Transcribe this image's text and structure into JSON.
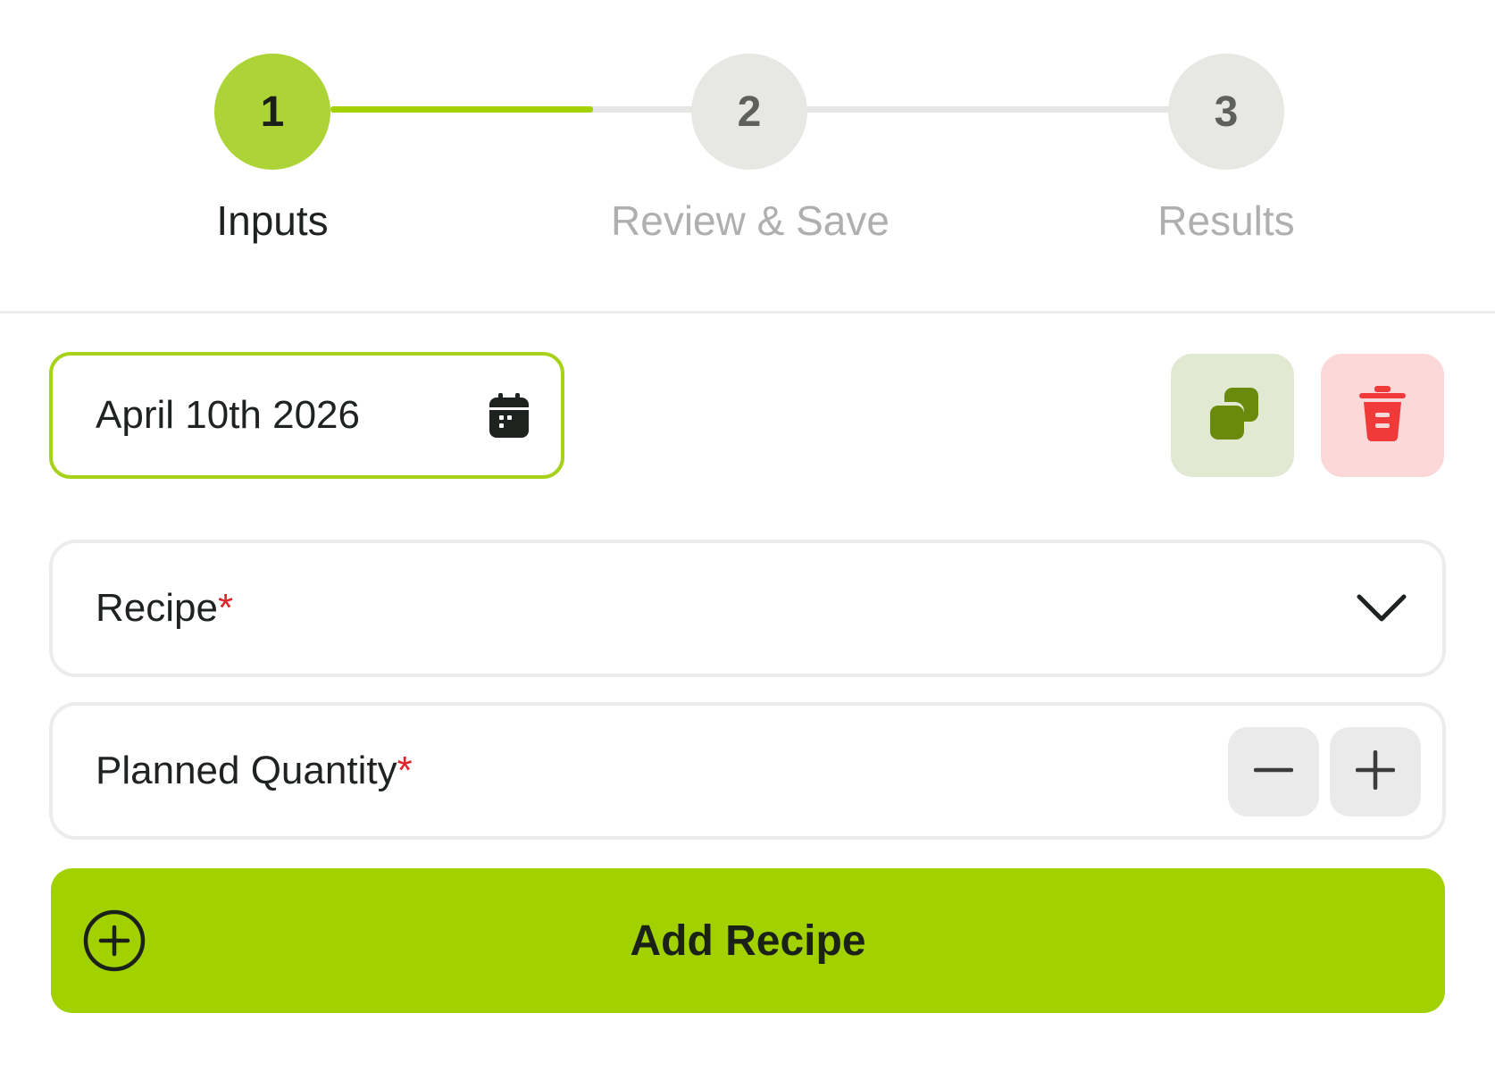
{
  "stepper": {
    "current_step": 1,
    "progress_to_next": 0.55,
    "steps": [
      {
        "number": "1",
        "label": "Inputs",
        "state": "active"
      },
      {
        "number": "2",
        "label": "Review & Save",
        "state": "pending"
      },
      {
        "number": "3",
        "label": "Results",
        "state": "pending"
      }
    ]
  },
  "date_picker": {
    "value": "April 10th 2026",
    "icon": "calendar-icon"
  },
  "actions": {
    "duplicate_icon": "duplicate-icon",
    "delete_icon": "trash-icon"
  },
  "recipe_field": {
    "label": "Recipe",
    "required_mark": "*",
    "icon": "chevron-down-icon"
  },
  "quantity_field": {
    "label": "Planned Quantity",
    "required_mark": "*",
    "decrement_icon": "minus-icon",
    "increment_icon": "plus-icon"
  },
  "add_button": {
    "label": "Add Recipe",
    "icon": "plus-circle-icon"
  },
  "colors": {
    "accent": "#a2d100",
    "accent_step": "#acd436",
    "danger": "#f03a3a",
    "danger_bg": "#fdd8d8",
    "copy_icon": "#6a8a0c",
    "copy_bg": "#e2e9d2",
    "required": "#e0242c"
  }
}
